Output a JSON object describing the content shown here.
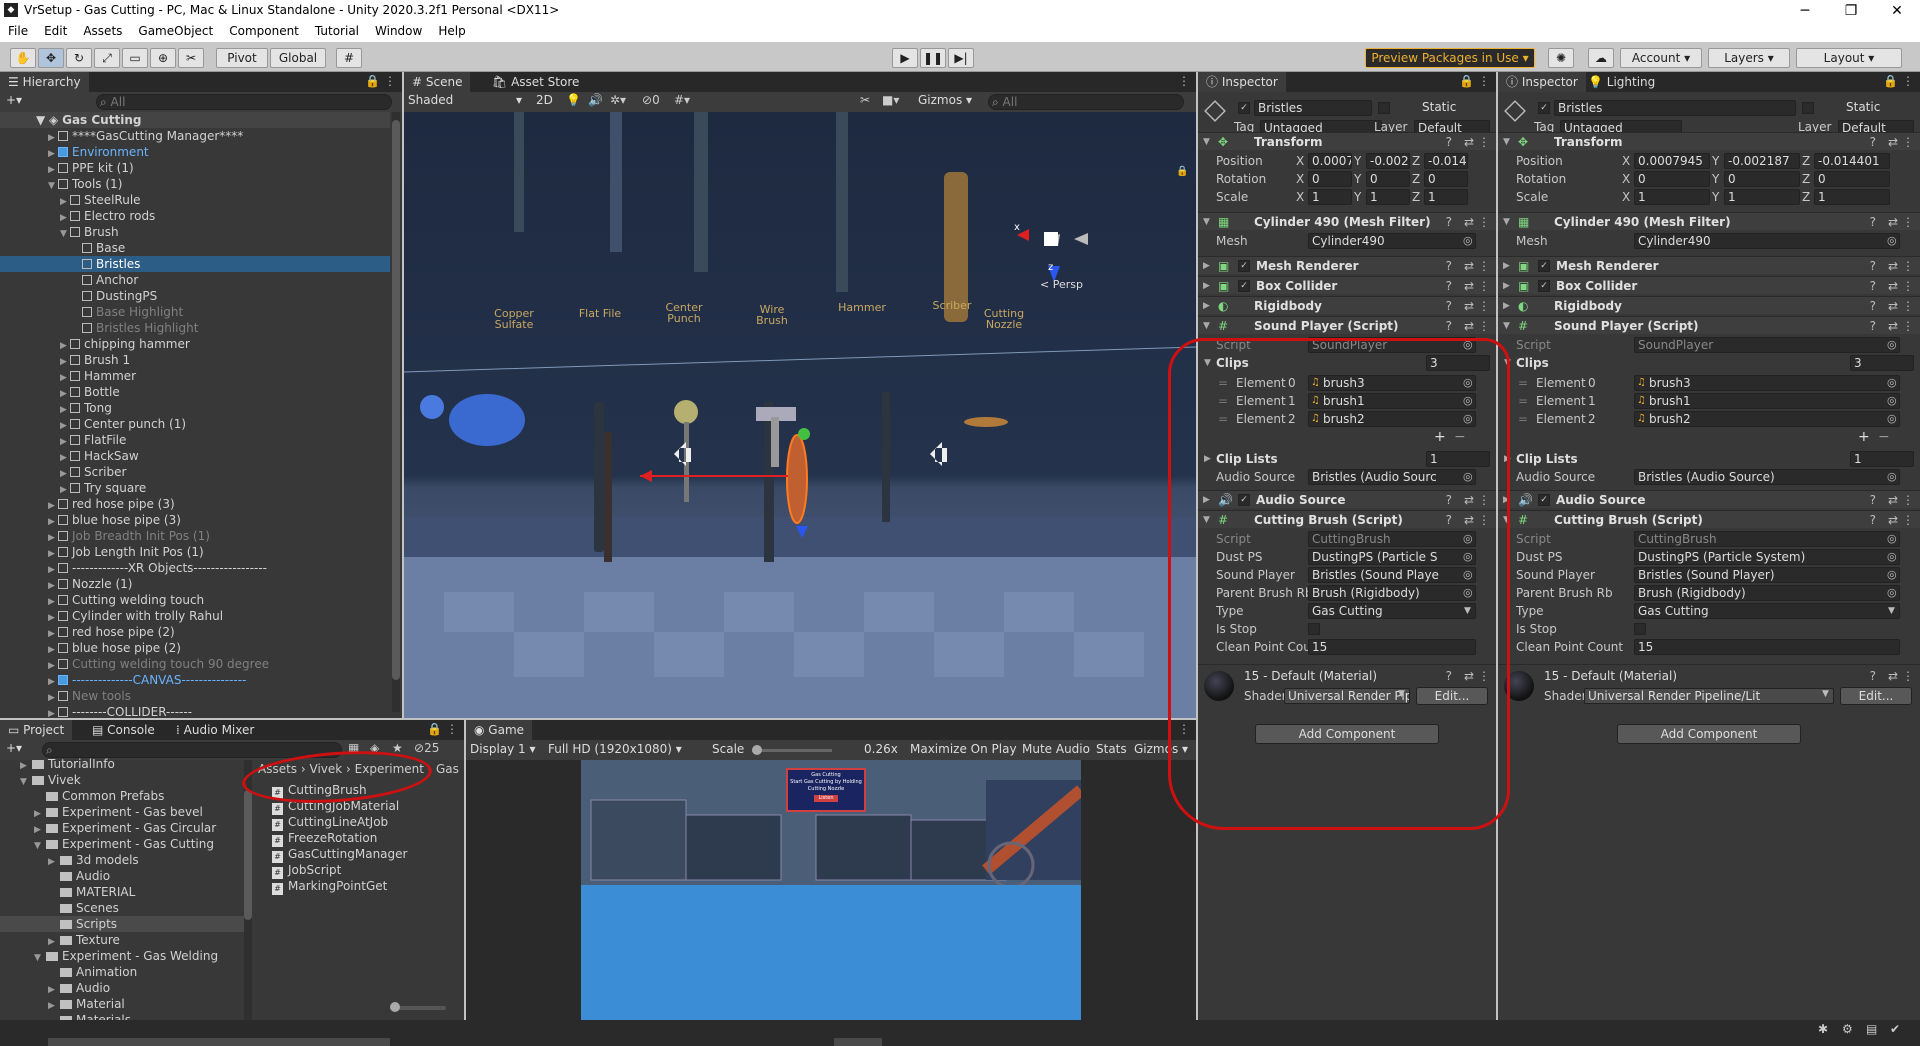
{
  "window": {
    "title": "VrSetup - Gas Cutting - PC, Mac & Linux Standalone - Unity 2020.3.2f1 Personal <DX11>",
    "minimize": "─",
    "maximize": "❐",
    "close": "✕"
  },
  "menu": [
    "File",
    "Edit",
    "Assets",
    "GameObject",
    "Component",
    "Tutorial",
    "Window",
    "Help"
  ],
  "toolbar": {
    "pivot": "Pivot",
    "global": "Global",
    "preview_packages": "Preview Packages in Use",
    "account": "Account",
    "layers": "Layers",
    "layout": "Layout"
  },
  "hierarchy": {
    "tab": "Hierarchy",
    "search_placeholder": "All",
    "scene": "Gas Cutting",
    "items": [
      {
        "label": "****GasCutting Manager****",
        "indent": 1,
        "state": "normal",
        "arrow": "▶"
      },
      {
        "label": "Environment",
        "indent": 1,
        "state": "blue",
        "arrow": "▶"
      },
      {
        "label": "PPE kit (1)",
        "indent": 1,
        "state": "normal",
        "arrow": "▶"
      },
      {
        "label": "Tools (1)",
        "indent": 1,
        "state": "normal",
        "arrow": "▼"
      },
      {
        "label": "SteelRule",
        "indent": 2,
        "state": "normal",
        "arrow": "▶"
      },
      {
        "label": "Electro rods",
        "indent": 2,
        "state": "normal",
        "arrow": "▶"
      },
      {
        "label": "Brush",
        "indent": 2,
        "state": "normal",
        "arrow": "▼"
      },
      {
        "label": "Base",
        "indent": 3,
        "state": "normal",
        "arrow": ""
      },
      {
        "label": "Bristles",
        "indent": 3,
        "state": "selected",
        "arrow": ""
      },
      {
        "label": "Anchor",
        "indent": 3,
        "state": "normal",
        "arrow": ""
      },
      {
        "label": "DustingPS",
        "indent": 3,
        "state": "normal",
        "arrow": ""
      },
      {
        "label": "Base Highlight",
        "indent": 3,
        "state": "grey",
        "arrow": ""
      },
      {
        "label": "Bristles Highlight",
        "indent": 3,
        "state": "grey",
        "arrow": ""
      },
      {
        "label": "chipping hammer",
        "indent": 2,
        "state": "normal",
        "arrow": "▶"
      },
      {
        "label": "Brush 1",
        "indent": 2,
        "state": "normal",
        "arrow": "▶"
      },
      {
        "label": "Hammer",
        "indent": 2,
        "state": "normal",
        "arrow": "▶"
      },
      {
        "label": "Bottle",
        "indent": 2,
        "state": "normal",
        "arrow": "▶"
      },
      {
        "label": "Tong",
        "indent": 2,
        "state": "normal",
        "arrow": "▶"
      },
      {
        "label": "Center punch (1)",
        "indent": 2,
        "state": "normal",
        "arrow": "▶"
      },
      {
        "label": "FlatFile",
        "indent": 2,
        "state": "normal",
        "arrow": "▶"
      },
      {
        "label": "HackSaw",
        "indent": 2,
        "state": "normal",
        "arrow": "▶"
      },
      {
        "label": "Scriber",
        "indent": 2,
        "state": "normal",
        "arrow": "▶"
      },
      {
        "label": "Try square",
        "indent": 2,
        "state": "normal",
        "arrow": "▶"
      },
      {
        "label": "red hose pipe (3)",
        "indent": 1,
        "state": "normal",
        "arrow": "▶"
      },
      {
        "label": "blue hose pipe (3)",
        "indent": 1,
        "state": "normal",
        "arrow": "▶"
      },
      {
        "label": "Job Breadth Init Pos (1)",
        "indent": 1,
        "state": "grey",
        "arrow": "▶"
      },
      {
        "label": "Job Length Init Pos (1)",
        "indent": 1,
        "state": "normal",
        "arrow": "▶"
      },
      {
        "label": "-------------XR Objects-----------------",
        "indent": 1,
        "state": "normal",
        "arrow": "▶"
      },
      {
        "label": "Nozzle (1)",
        "indent": 1,
        "state": "normal",
        "arrow": "▶"
      },
      {
        "label": "Cutting welding touch",
        "indent": 1,
        "state": "normal",
        "arrow": "▶"
      },
      {
        "label": "Cylinder with trolly Rahul",
        "indent": 1,
        "state": "normal",
        "arrow": "▶"
      },
      {
        "label": "red hose pipe (2)",
        "indent": 1,
        "state": "normal",
        "arrow": "▶"
      },
      {
        "label": "blue hose pipe (2)",
        "indent": 1,
        "state": "normal",
        "arrow": "▶"
      },
      {
        "label": "Cutting welding touch  90 degree",
        "indent": 1,
        "state": "grey",
        "arrow": "▶"
      },
      {
        "label": "--------------CANVAS---------------",
        "indent": 1,
        "state": "blue",
        "arrow": "▶"
      },
      {
        "label": "New tools",
        "indent": 1,
        "state": "grey",
        "arrow": "▶"
      },
      {
        "label": "--------COLLIDER------",
        "indent": 1,
        "state": "normal",
        "arrow": "▶"
      }
    ]
  },
  "scene": {
    "tabs": [
      "Scene",
      "Asset Store"
    ],
    "shading": "Shaded",
    "mode2d": "2D",
    "gizmos": "Gizmos",
    "search_placeholder": "All",
    "persp": "Persp",
    "hidden_count": "0",
    "labels": [
      "Copper\nSulfate",
      "Flat File",
      "Center\nPunch",
      "Wire\nBrush",
      "Hammer",
      "Scriber",
      "Cutting\nNozzle"
    ]
  },
  "project": {
    "tabs": [
      "Project",
      "Console",
      "Audio Mixer"
    ],
    "hidden_count": "25",
    "tree": [
      {
        "label": "TutorialInfo",
        "indent": 1,
        "arrow": "▶"
      },
      {
        "label": "Vivek",
        "indent": 1,
        "arrow": "▼"
      },
      {
        "label": "Common Prefabs",
        "indent": 2,
        "arrow": ""
      },
      {
        "label": "Experiment - Gas bevel",
        "indent": 2,
        "arrow": "▶"
      },
      {
        "label": "Experiment - Gas Circular",
        "indent": 2,
        "arrow": "▶"
      },
      {
        "label": "Experiment - Gas Cutting",
        "indent": 2,
        "arrow": "▼"
      },
      {
        "label": "3d models",
        "indent": 3,
        "arrow": "▶"
      },
      {
        "label": "Audio",
        "indent": 3,
        "arrow": ""
      },
      {
        "label": "MATERIAL",
        "indent": 3,
        "arrow": ""
      },
      {
        "label": "Scenes",
        "indent": 3,
        "arrow": ""
      },
      {
        "label": "Scripts",
        "indent": 3,
        "arrow": "",
        "selected": true
      },
      {
        "label": "Texture",
        "indent": 3,
        "arrow": "▶"
      },
      {
        "label": "Experiment - Gas Welding",
        "indent": 2,
        "arrow": "▼"
      },
      {
        "label": "Animation",
        "indent": 3,
        "arrow": ""
      },
      {
        "label": "Audio",
        "indent": 3,
        "arrow": "▶"
      },
      {
        "label": "Material",
        "indent": 3,
        "arrow": "▶"
      },
      {
        "label": "Materials",
        "indent": 3,
        "arrow": ""
      }
    ],
    "breadcrumb": [
      "Assets",
      "Vivek",
      "Experiment - Gas"
    ],
    "files": [
      "CuttingBrush",
      "CuttingJobMaterial",
      "CuttingLineAtJob",
      "FreezeRotation",
      "GasCuttingManager",
      "JobScript",
      "MarkingPointGet"
    ]
  },
  "game": {
    "tab": "Game",
    "display": "Display 1",
    "resolution": "Full HD (1920x1080)",
    "scale_label": "Scale",
    "scale_value": "0.26x",
    "maximize": "Maximize On Play",
    "mute": "Mute Audio",
    "stats": "Stats",
    "gizmos": "Gizmos",
    "sign_title": "Gas Cutting",
    "sign_body": "Start Gas Cutting by Holding Cutting Nozzle",
    "sign_btn": "Listen"
  },
  "inspector": [
    {
      "tab": "Inspector",
      "tab2": "",
      "name": "Bristles",
      "static": "Static",
      "tag_label": "Tag",
      "tag": "Untagged",
      "layer_label": "Layer",
      "layer": "Default",
      "transform": {
        "title": "Transform",
        "position": [
          "0.0007",
          "-0.002",
          "-0.014"
        ],
        "rotation": [
          "0",
          "0",
          "0"
        ],
        "scale": [
          "1",
          "1",
          "1"
        ]
      },
      "meshfilter": {
        "title": "Cylinder 490 (Mesh Filter)",
        "mesh": "Cylinder490"
      },
      "sound": {
        "script": "SoundPlayer",
        "clips_size": "3",
        "clips": [
          "brush3",
          "brush1",
          "brush2"
        ],
        "cliplists_size": "1",
        "audio_source": "Bristles (Audio Sourc"
      },
      "cutting": {
        "script": "CuttingBrush",
        "dust": "DustingPS (Particle S",
        "sound": "Bristles (Sound Playe",
        "rb": "Brush (Rigidbody)",
        "type": "Gas Cutting",
        "clean": "15"
      },
      "material": {
        "name": "15 - Default (Material)",
        "shader": "Universal Render Pipe"
      }
    },
    {
      "tab": "Inspector",
      "tab2": "Lighting",
      "name": "Bristles",
      "static": "Static",
      "tag_label": "Tag",
      "tag": "Untagged",
      "layer_label": "Layer",
      "layer": "Default",
      "transform": {
        "title": "Transform",
        "position": [
          "0.0007945",
          "-0.002187",
          "-0.014401"
        ],
        "rotation": [
          "0",
          "0",
          "0"
        ],
        "scale": [
          "1",
          "1",
          "1"
        ]
      },
      "meshfilter": {
        "title": "Cylinder 490 (Mesh Filter)",
        "mesh": "Cylinder490"
      },
      "sound": {
        "script": "SoundPlayer",
        "clips_size": "3",
        "clips": [
          "brush3",
          "brush1",
          "brush2"
        ],
        "cliplists_size": "1",
        "audio_source": "Bristles (Audio Source)"
      },
      "cutting": {
        "script": "CuttingBrush",
        "dust": "DustingPS (Particle System)",
        "sound": "Bristles (Sound Player)",
        "rb": "Brush (Rigidbody)",
        "type": "Gas Cutting",
        "clean": "15"
      },
      "material": {
        "name": "15 - Default (Material)",
        "shader": "Universal Render Pipeline/Lit"
      }
    }
  ],
  "labels": {
    "position": "Position",
    "rotation": "Rotation",
    "scale": "Scale",
    "mesh": "Mesh",
    "mesh_renderer": "Mesh Renderer",
    "box_collider": "Box Collider",
    "rigidbody": "Rigidbody",
    "sound_player": "Sound Player (Script)",
    "script": "Script",
    "clips": "Clips",
    "element": "Element",
    "clip_lists": "Clip Lists",
    "audio_source_field": "Audio Source",
    "audio_source": "Audio Source",
    "cutting_brush": "Cutting Brush (Script)",
    "dust_ps": "Dust PS",
    "sound_player_field": "Sound Player",
    "parent_rb": "Parent Brush Rb",
    "type": "Type",
    "is_stop": "Is Stop",
    "clean": "Clean Point Count",
    "shader": "Shader",
    "edit": "Edit...",
    "add_component": "Add Component"
  },
  "colors": {
    "accent": "#2c5d87",
    "annotation": "#d01010"
  }
}
